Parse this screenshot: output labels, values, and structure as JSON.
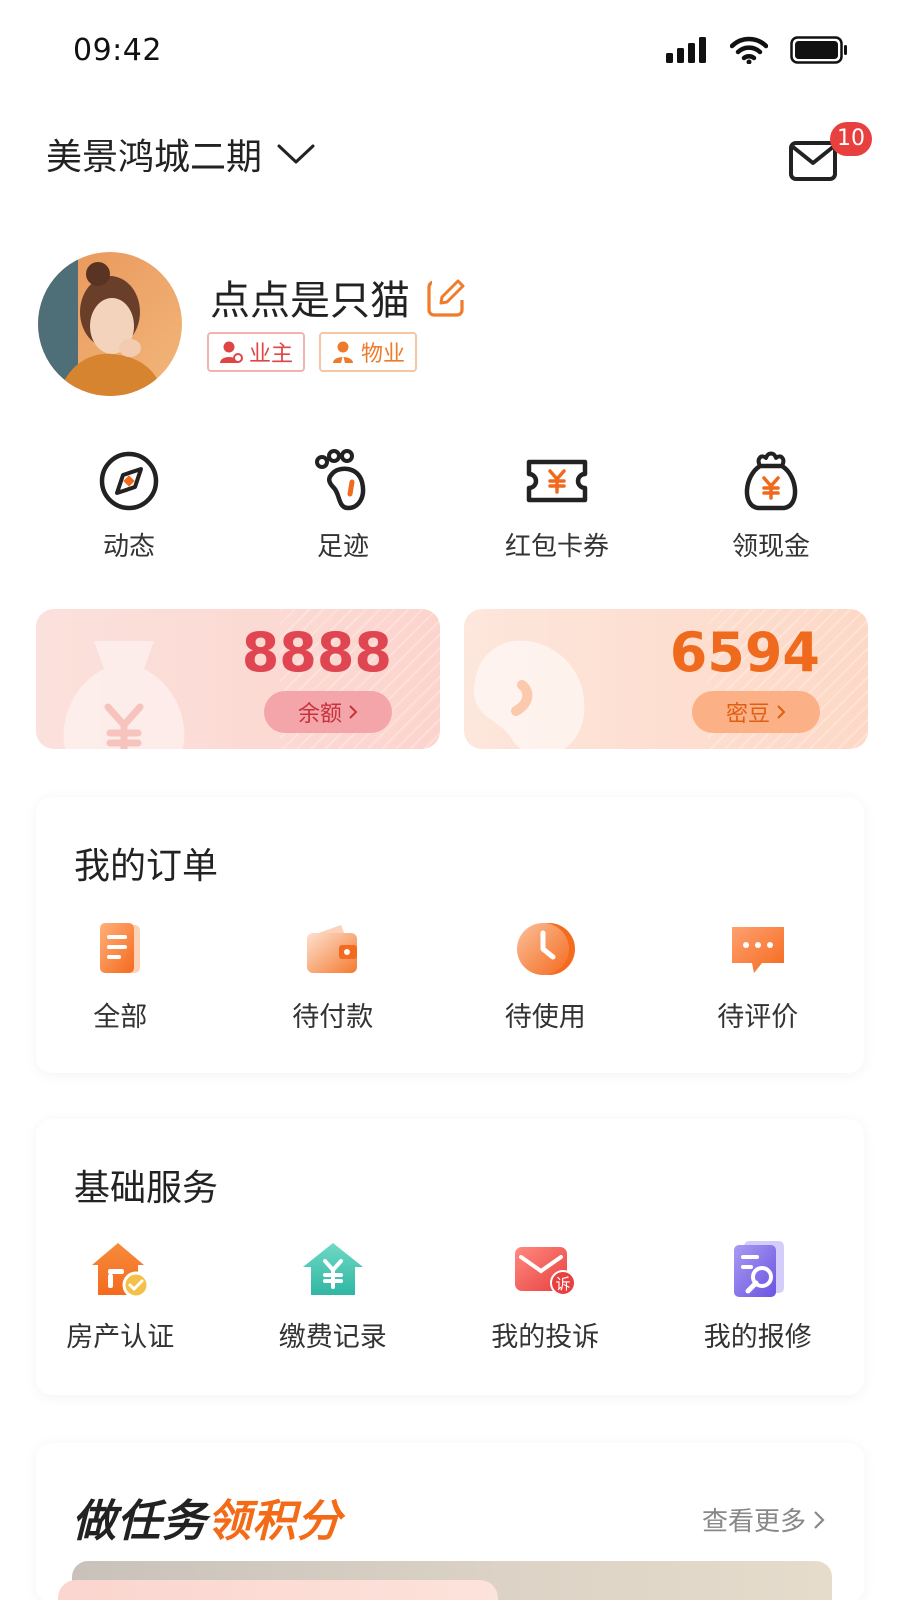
{
  "status_bar": {
    "time": "09:42",
    "battery_level": 1.0
  },
  "header": {
    "community_name": "美景鸿城二期",
    "mail_badge": "10"
  },
  "profile": {
    "nickname": "点点是只猫",
    "tags": [
      {
        "label": "业主",
        "icon": "owner-person-icon"
      },
      {
        "label": "物业",
        "icon": "staff-person-icon"
      }
    ]
  },
  "quick_actions": [
    {
      "label": "动态",
      "icon": "compass-icon"
    },
    {
      "label": "足迹",
      "icon": "footprint-icon"
    },
    {
      "label": "红包卡券",
      "icon": "coupon-ticket-icon"
    },
    {
      "label": "领现金",
      "icon": "money-bag-icon"
    }
  ],
  "wallet": {
    "balance": {
      "value": "8888",
      "label": "余额"
    },
    "beans": {
      "value": "6594",
      "label": "密豆"
    }
  },
  "orders": {
    "title": "我的订单",
    "items": [
      {
        "label": "全部",
        "icon": "document-list-icon"
      },
      {
        "label": "待付款",
        "icon": "wallet-icon"
      },
      {
        "label": "待使用",
        "icon": "clock-icon"
      },
      {
        "label": "待评价",
        "icon": "chat-bubble-icon"
      }
    ]
  },
  "services": {
    "title": "基础服务",
    "items": [
      {
        "label": "房产认证",
        "icon": "house-verified-icon"
      },
      {
        "label": "缴费记录",
        "icon": "payment-house-icon"
      },
      {
        "label": "我的投诉",
        "icon": "complaint-mail-icon",
        "icon_text": "诉"
      },
      {
        "label": "我的报修",
        "icon": "repair-wrench-icon"
      }
    ]
  },
  "tasks": {
    "title_part1": "做任务",
    "title_part2": "领积分",
    "more": "查看更多"
  },
  "colors": {
    "accent_orange": "#f06a1d",
    "accent_red": "#e04552",
    "badge_red": "#e8403f"
  }
}
